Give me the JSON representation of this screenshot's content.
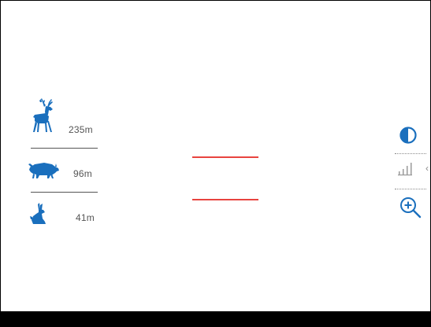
{
  "stadiametric": {
    "items": [
      {
        "animal": "deer",
        "icon": "deer-icon",
        "distance": "235m"
      },
      {
        "animal": "boar",
        "icon": "boar-icon",
        "distance": "96m"
      },
      {
        "animal": "hare",
        "icon": "hare-icon",
        "distance": "41m"
      }
    ]
  },
  "side_menu": {
    "icons": [
      "contrast-icon",
      "signal-bars-icon",
      "zoom-in-icon"
    ]
  },
  "colors": {
    "accent": "#1a6fbd",
    "reticle": "#e8443f",
    "text": "#555555",
    "bottom_bar": "#000000"
  }
}
